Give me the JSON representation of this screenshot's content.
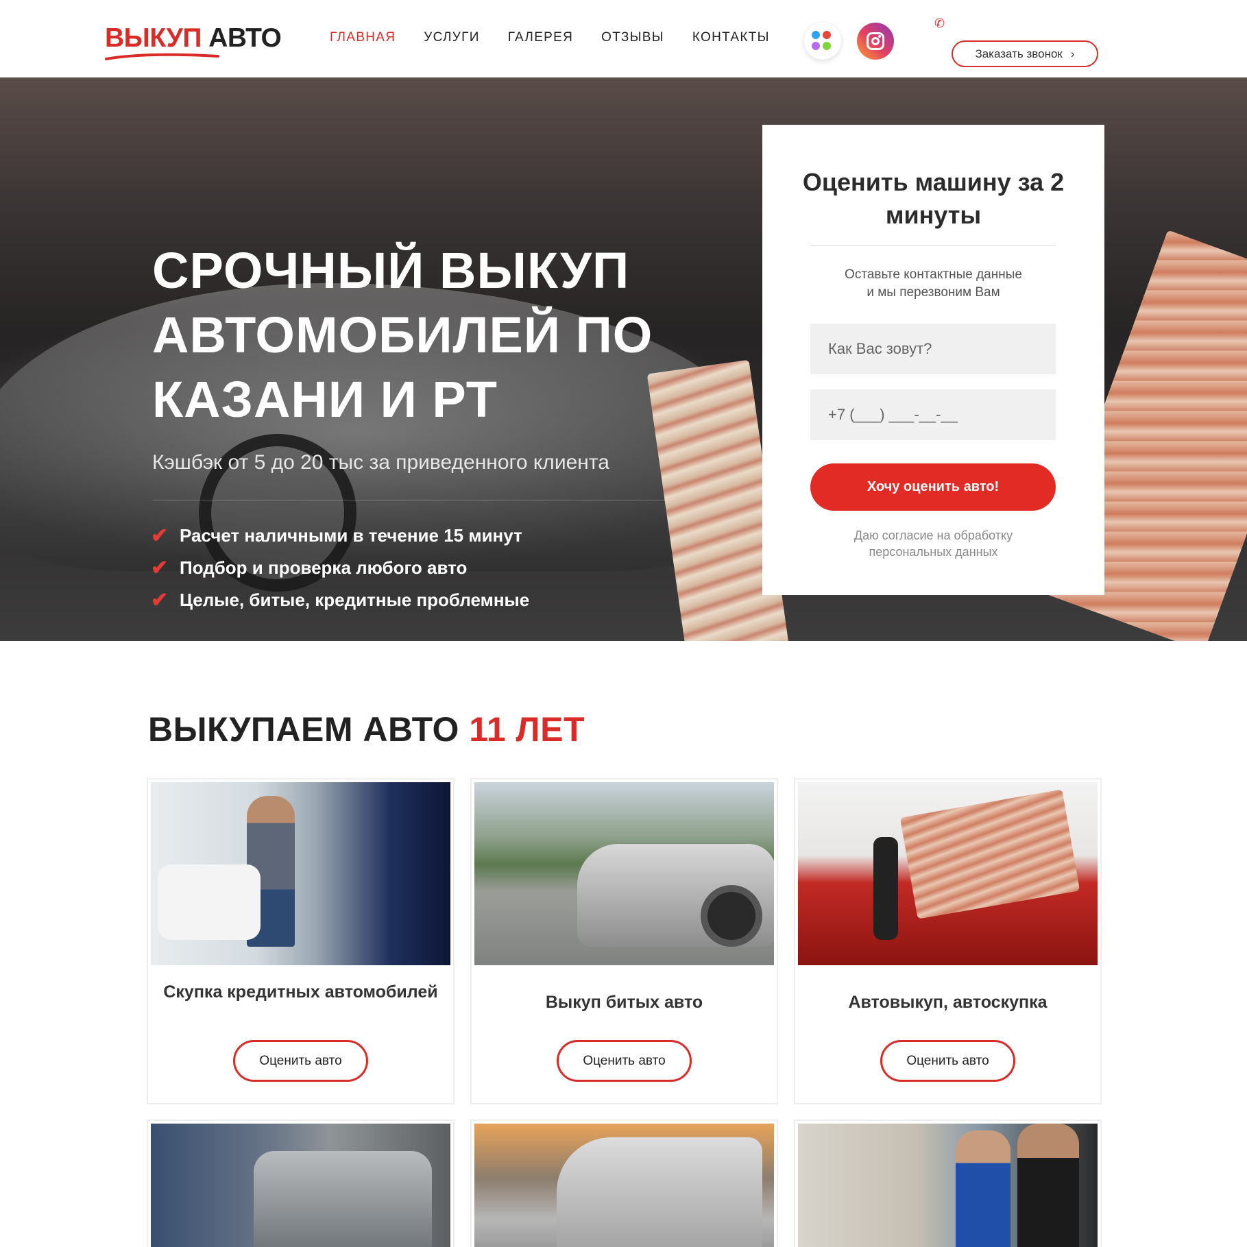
{
  "header": {
    "logo_red": "ВЫКУП",
    "logo_dark": "АВТО",
    "nav": [
      {
        "label": "ГЛАВНАЯ",
        "active": true
      },
      {
        "label": "УСЛУГИ",
        "active": false
      },
      {
        "label": "ГАЛЕРЕЯ",
        "active": false
      },
      {
        "label": "ОТЗЫВЫ",
        "active": false
      },
      {
        "label": "КОНТАКТЫ",
        "active": false
      }
    ],
    "callback_label": "Заказать звонок",
    "phone_icon": "phone-icon",
    "social_icons": [
      "dots-icon",
      "instagram-icon"
    ]
  },
  "hero": {
    "title": "СРОЧНЫЙ ВЫКУП АВТОМОБИЛЕЙ ПО КАЗАНИ И РТ",
    "subtitle": "Кэшбэк от 5 до 20 тыс за приведенного клиента",
    "benefits": [
      "Расчет наличными в течение 15 минут",
      "Подбор и проверка любого авто",
      "Целые, битые, кредитные проблемные"
    ]
  },
  "form": {
    "title": "Оценить машину за 2 минуты",
    "description_line1": "Оставьте контактные данные",
    "description_line2": "и мы перезвоним Вам",
    "name_placeholder": "Как Вас зовут?",
    "phone_placeholder": "+7 (___) ___-__-__",
    "submit_label": "Хочу оценить авто!",
    "consent_line1": "Даю согласие на обработку",
    "consent_line2": "персональных данных"
  },
  "services": {
    "title_main": "ВЫКУПАЕМ АВТО",
    "title_accent": "11 ЛЕТ",
    "cards": [
      {
        "title": "Скупка кредитных автомобилей",
        "button": "Оценить авто"
      },
      {
        "title": "Выкуп битых авто",
        "button": "Оценить авто"
      },
      {
        "title": "Автовыкуп, автоскупка",
        "button": "Оценить авто"
      }
    ]
  },
  "colors": {
    "accent": "#d92b27",
    "text": "#222222",
    "form_bg": "#ffffff",
    "input_bg": "#f0f0f0"
  }
}
